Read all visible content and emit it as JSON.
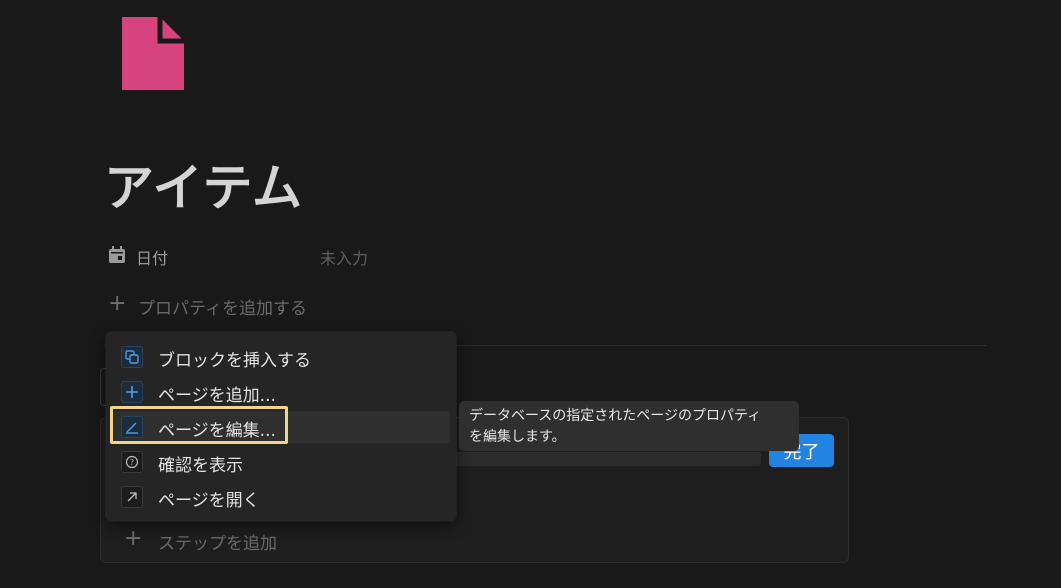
{
  "page": {
    "title": "アイテム",
    "icon": "document-icon",
    "icon_color": "#d6437f"
  },
  "properties": [
    {
      "icon": "calendar-icon",
      "name": "日付",
      "value": "未入力"
    }
  ],
  "add_property_label": "プロパティを追加する",
  "steps": {
    "done_label": "完了",
    "done_color": "#2383e2",
    "add_step_label": "ステップを追加"
  },
  "context_menu": {
    "items": [
      {
        "icon": "copy-icon",
        "label": "ブロックを挿入する"
      },
      {
        "icon": "plus-icon",
        "label": "ページを追加..."
      },
      {
        "icon": "edit-icon",
        "label": "ページを編集..."
      },
      {
        "icon": "question-icon",
        "label": "確認を表示"
      },
      {
        "icon": "open-arrow-icon",
        "label": "ページを開く"
      }
    ],
    "active_index": 2
  },
  "tooltip": {
    "line1": "データベースの指定されたページのプロパティ",
    "line2": "を編集します。"
  }
}
